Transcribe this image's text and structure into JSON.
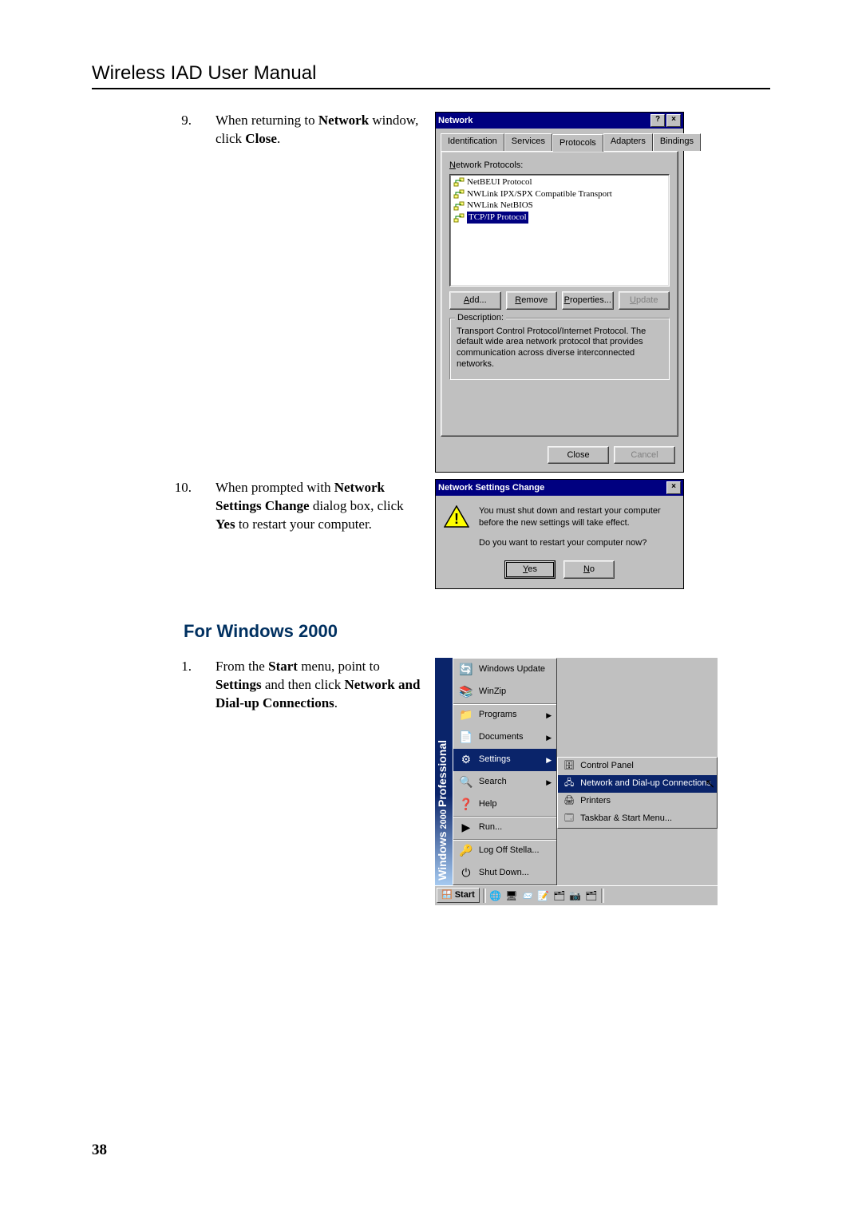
{
  "header": {
    "title": "Wireless IAD User Manual"
  },
  "page_number": "38",
  "step9": {
    "num": "9.",
    "text_before": "When returning to ",
    "bold1": "Network",
    "text_mid": " window, click ",
    "bold2": "Close",
    "text_after": "."
  },
  "step10": {
    "num": "10.",
    "p1a": "When prompted with ",
    "p1b": "Network Settings Change",
    "p1c": " dialog box, click ",
    "p1d": "Yes",
    "p1e": " to restart your computer."
  },
  "section_w2k": {
    "title": "For Windows 2000"
  },
  "step1": {
    "num": "1.",
    "a": "From the ",
    "b": "Start",
    "c": " menu, point to ",
    "d": "Settings",
    "e": " and then click ",
    "f": "Network and Dial-up Connections",
    "g": "."
  },
  "dlg_network": {
    "title": "Network",
    "tabs": [
      "Identification",
      "Services",
      "Protocols",
      "Adapters",
      "Bindings"
    ],
    "active_tab": 2,
    "list_label_pre": "N",
    "list_label": "etwork Protocols:",
    "protocols": [
      "NetBEUI Protocol",
      "NWLink IPX/SPX Compatible Transport",
      "NWLink NetBIOS",
      "TCP/IP Protocol"
    ],
    "selected_protocol": 3,
    "btn_add_u": "A",
    "btn_add": "dd...",
    "btn_remove_u": "R",
    "btn_remove": "emove",
    "btn_props_u": "P",
    "btn_props": "roperties...",
    "btn_update_u": "U",
    "btn_update": "pdate",
    "desc_legend": "Description:",
    "desc_text": "Transport Control Protocol/Internet Protocol. The default wide area network protocol that provides communication across diverse interconnected networks.",
    "btn_close": "Close",
    "btn_cancel": "Cancel"
  },
  "dlg_nsc": {
    "title": "Network Settings Change",
    "msg1": "You must shut down and restart your computer before the new settings will take effect.",
    "msg2": "Do you want to restart your computer now?",
    "yes_u": "Y",
    "yes": "es",
    "no_u": "N",
    "no": "o"
  },
  "startmenu": {
    "band": "Windows 2000 Professional",
    "items": [
      {
        "label": "Windows Update",
        "icon": "🔄"
      },
      {
        "label": "WinZip",
        "icon": "📚"
      },
      {
        "label": "Programs",
        "icon": "📁",
        "arrow": true,
        "sep": true
      },
      {
        "label": "Documents",
        "icon": "📄",
        "arrow": true
      },
      {
        "label": "Settings",
        "icon": "⚙",
        "arrow": true,
        "hi": true
      },
      {
        "label": "Search",
        "icon": "🔍",
        "arrow": true
      },
      {
        "label": "Help",
        "icon": "❓"
      },
      {
        "label": "Run...",
        "icon": "▶",
        "sep": true
      },
      {
        "label": "Log Off Stella...",
        "icon": "🔑",
        "sep": true
      },
      {
        "label": "Shut Down...",
        "icon": "⏻"
      }
    ],
    "submenu": [
      {
        "label": "Control Panel",
        "icon": "🗄"
      },
      {
        "label": "Network and Dial-up Connections",
        "icon": "🖧",
        "hi": true
      },
      {
        "label": "Printers",
        "icon": "🖨"
      },
      {
        "label": "Taskbar & Start Menu...",
        "icon": "🗔"
      }
    ],
    "start_label": "Start"
  }
}
